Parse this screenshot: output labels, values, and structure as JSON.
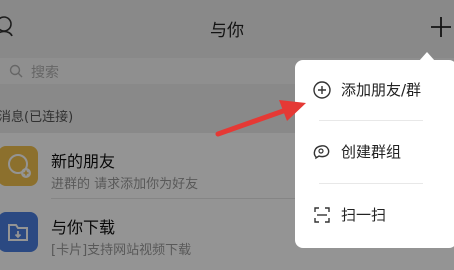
{
  "header": {
    "title": "与你"
  },
  "search": {
    "placeholder": "搜索"
  },
  "section": {
    "label": "消息(已连接)"
  },
  "list": [
    {
      "title": "新的朋友",
      "subtitle": "进群的 请求添加你为好友",
      "avatar_color": "#f2c14e",
      "icon": "add-friend-icon"
    },
    {
      "title": "与你下载",
      "subtitle": "[卡片]支持网站视频下载",
      "avatar_color": "#4a7fe0",
      "icon": "download-folder-icon"
    }
  ],
  "menu": {
    "items": [
      {
        "label": "添加朋友/群",
        "icon": "add-circle-icon"
      },
      {
        "label": "创建群组",
        "icon": "group-chat-icon"
      },
      {
        "label": "扫一扫",
        "icon": "scan-icon"
      }
    ]
  },
  "annotation": {
    "arrow_color": "#e53935"
  }
}
